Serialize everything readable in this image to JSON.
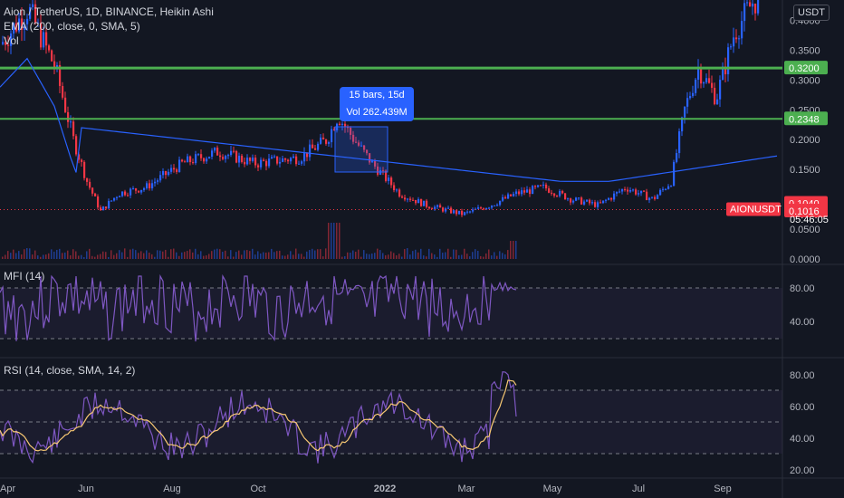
{
  "header": {
    "title": "Aion / TetherUS, 1D, BINANCE, Heikin Ashi",
    "ema": "EMA (200, close, 0, SMA, 5)",
    "vol": "Vol",
    "currency": "USDT"
  },
  "tooltip": {
    "range": "15 bars, 15d",
    "volume": "Vol 262.439M"
  },
  "price_axis": {
    "ticks": [
      "0.4000",
      "0.3500",
      "0.3000",
      "0.2500",
      "0.2000",
      "0.1500",
      "0.0500",
      "0.0000"
    ],
    "tags": [
      {
        "label": "0.3200",
        "color": "#4caf50",
        "text_color": "#131722"
      },
      {
        "label": "0.2348",
        "color": "#4caf50",
        "text_color": "#131722"
      },
      {
        "label": "0.1040",
        "color": "#f23645",
        "text_color": "#ffffff"
      },
      {
        "label": "0.1016",
        "color": "#f23645",
        "text_color": "#ffffff"
      }
    ],
    "symbol_tag": "AIONUSDT",
    "countdown": "05:46:05"
  },
  "mfi": {
    "label": "MFI (14)",
    "ticks": [
      "80.00",
      "40.00"
    ]
  },
  "rsi": {
    "label": "RSI (14, close, SMA, 14, 2)",
    "ticks": [
      "80.00",
      "60.00",
      "40.00",
      "20.00"
    ]
  },
  "time_axis": {
    "labels": [
      "Apr",
      "Jun",
      "Aug",
      "Oct",
      "2022",
      "Mar",
      "May",
      "Jul",
      "Sep"
    ]
  },
  "colors": {
    "background": "#131722",
    "up": "#2962ff",
    "down": "#f23645",
    "green_line": "#4caf50",
    "ema": "#2962ff",
    "indicator": "#7e57c2",
    "rsi_ma": "#f7c873"
  },
  "chart_data": {
    "type": "candlestick",
    "price_levels": [
      0.32,
      0.2348
    ],
    "last_price": 0.1016,
    "last_close_line": 0.104
  }
}
